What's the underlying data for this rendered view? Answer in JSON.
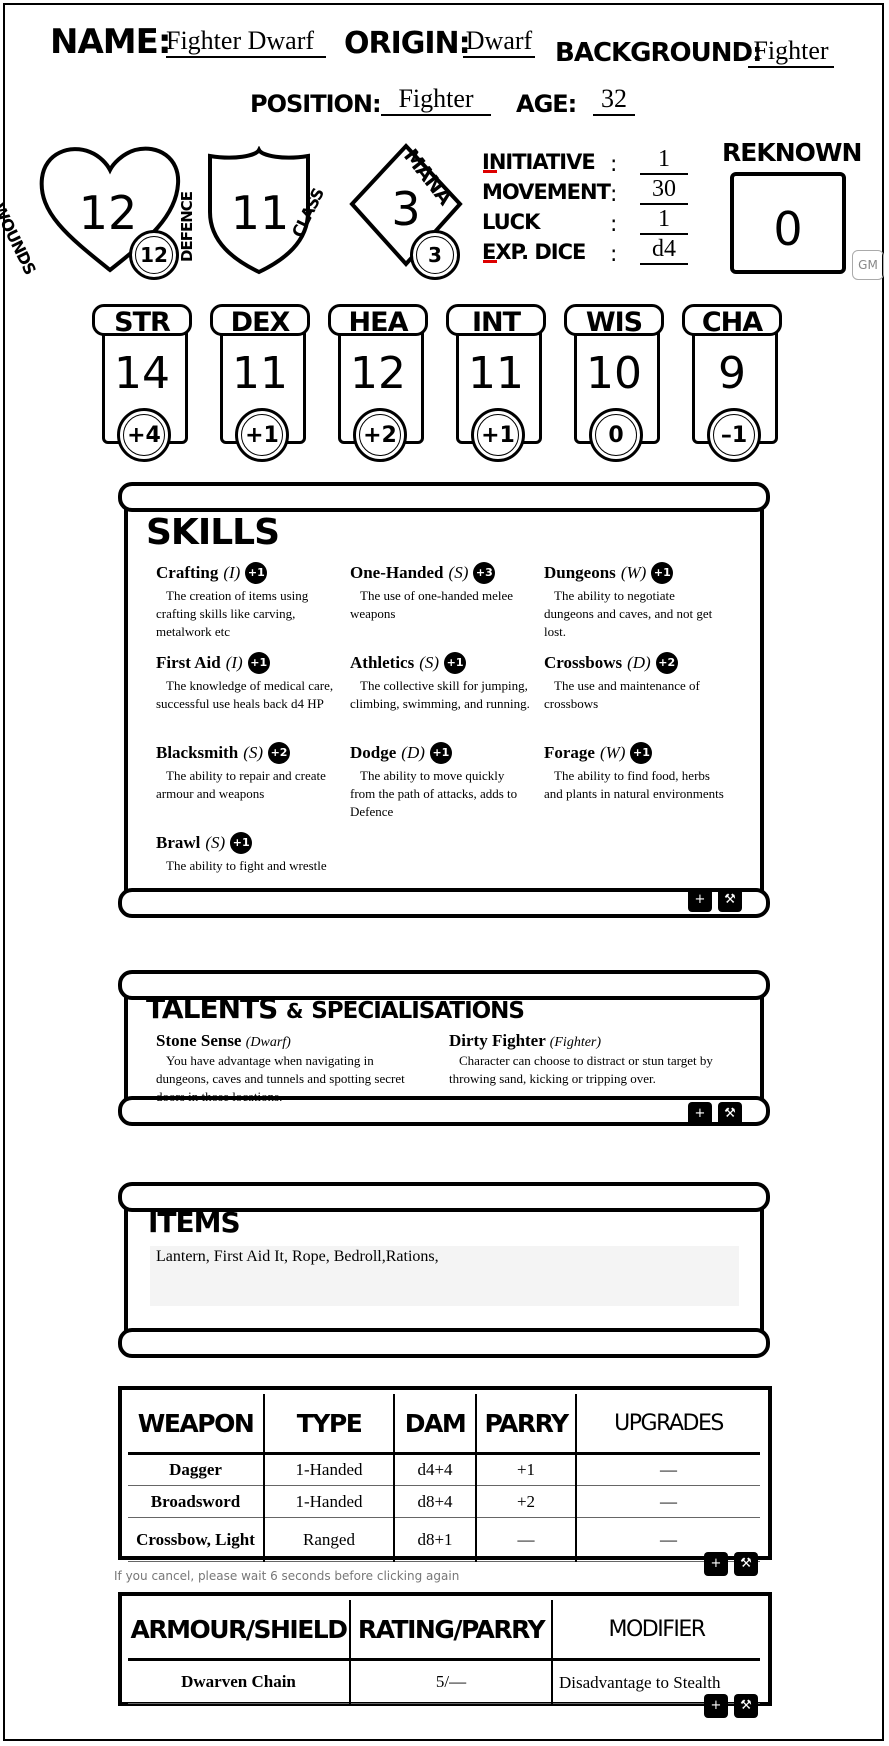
{
  "header": {
    "name_label": "NAME:",
    "name_value": "Fighter Dwarf",
    "origin_label": "ORIGIN:",
    "origin_value": "Dwarf",
    "background_label": "BACKGROUND:",
    "background_value": "Fighter",
    "position_label": "POSITION:",
    "position_value": "Fighter",
    "age_label": "AGE:",
    "age_value": "32"
  },
  "vitals": {
    "wounds_label": "WOUNDS",
    "wounds_value": "12",
    "wounds_max": "12",
    "defence_label": "DEFENCE",
    "defence_value": "11",
    "class_label": "CLASS",
    "mana_label": "MANA",
    "mana_value": "3",
    "mana_max": "3"
  },
  "stats": {
    "initiative_label": "INITIATIVE",
    "initiative_value": "1",
    "movement_label": "MOVEMENT",
    "movement_value": "30",
    "luck_label": "LUCK",
    "luck_value": "1",
    "exp_label": "EXP. DICE",
    "exp_value": "d4"
  },
  "renown": {
    "label": "REKNOWN",
    "value": "0"
  },
  "gm_button": "GM",
  "abilities": [
    {
      "name": "STR",
      "score": "14",
      "mod": "+4"
    },
    {
      "name": "DEX",
      "score": "11",
      "mod": "+1"
    },
    {
      "name": "HEA",
      "score": "12",
      "mod": "+2"
    },
    {
      "name": "INT",
      "score": "11",
      "mod": "+1"
    },
    {
      "name": "WIS",
      "score": "10",
      "mod": "0"
    },
    {
      "name": "CHA",
      "score": "9",
      "mod": "–1"
    }
  ],
  "skills": {
    "title": "SKILLS",
    "list": [
      {
        "name": "Crafting",
        "attr": "(I)",
        "bonus": "+1",
        "desc": "The creation of items using crafting skills like carving, metalwork etc"
      },
      {
        "name": "One-Handed",
        "attr": "(S)",
        "bonus": "+3",
        "desc": "The use of one-handed melee weapons"
      },
      {
        "name": "Dungeons",
        "attr": "(W)",
        "bonus": "+1",
        "desc": "The ability to negotiate dungeons and caves, and not get lost."
      },
      {
        "name": "First Aid",
        "attr": "(I)",
        "bonus": "+1",
        "desc": "The knowledge of medical care, successful use heals back d4 HP"
      },
      {
        "name": "Athletics",
        "attr": "(S)",
        "bonus": "+1",
        "desc": "The collective skill for jumping, climbing, swimming, and running."
      },
      {
        "name": "Crossbows",
        "attr": "(D)",
        "bonus": "+2",
        "desc": "The use and maintenance of crossbows"
      },
      {
        "name": "Blacksmith",
        "attr": "(S)",
        "bonus": "+2",
        "desc": "The ability to repair and create armour and weapons"
      },
      {
        "name": "Dodge",
        "attr": "(D)",
        "bonus": "+1",
        "desc": "The ability to move quickly from the path of attacks, adds to Defence"
      },
      {
        "name": "Forage",
        "attr": "(W)",
        "bonus": "+1",
        "desc": "The ability to find food, herbs and plants in natural environments"
      },
      {
        "name": "Brawl",
        "attr": "(S)",
        "bonus": "+1",
        "desc": "The ability to fight and wrestle"
      }
    ]
  },
  "talents": {
    "title_a": "TALENTS",
    "title_amp": "&",
    "title_b": "SPECIALISATIONS",
    "list": [
      {
        "name": "Stone Sense",
        "source": "(Dwarf)",
        "desc": "You have advantage when navigating in dungeons, caves and tunnels and spotting secret doors in those locations."
      },
      {
        "name": "Dirty Fighter",
        "source": "(Fighter)",
        "desc": "Character can choose to distract or stun target by throwing sand, kicking or tripping over."
      }
    ]
  },
  "items": {
    "title": "ITEMS",
    "text": "Lantern, First Aid It, Rope, Bedroll,Rations,"
  },
  "weapons": {
    "headers": [
      "WEAPON",
      "TYPE",
      "DAM",
      "PARRY",
      "UPGRADES"
    ],
    "rows": [
      [
        "Dagger",
        "1-Handed",
        "d4+4",
        "+1",
        "—"
      ],
      [
        "Broadsword",
        "1-Handed",
        "d8+4",
        "+2",
        "—"
      ],
      [
        "Crossbow, Light",
        "Ranged",
        "d8+1",
        "—",
        "—"
      ]
    ]
  },
  "cancel_note": "If you cancel, please wait 6 seconds before clicking again",
  "armour": {
    "headers": [
      "ARMOUR/SHIELD",
      "RATING/PARRY",
      "MODIFIER"
    ],
    "rows": [
      [
        "Dwarven Chain",
        "5/—",
        "Disadvantage to Stealth"
      ]
    ]
  },
  "buttons": {
    "add_icon": "+",
    "edit_icon": "⚒"
  }
}
